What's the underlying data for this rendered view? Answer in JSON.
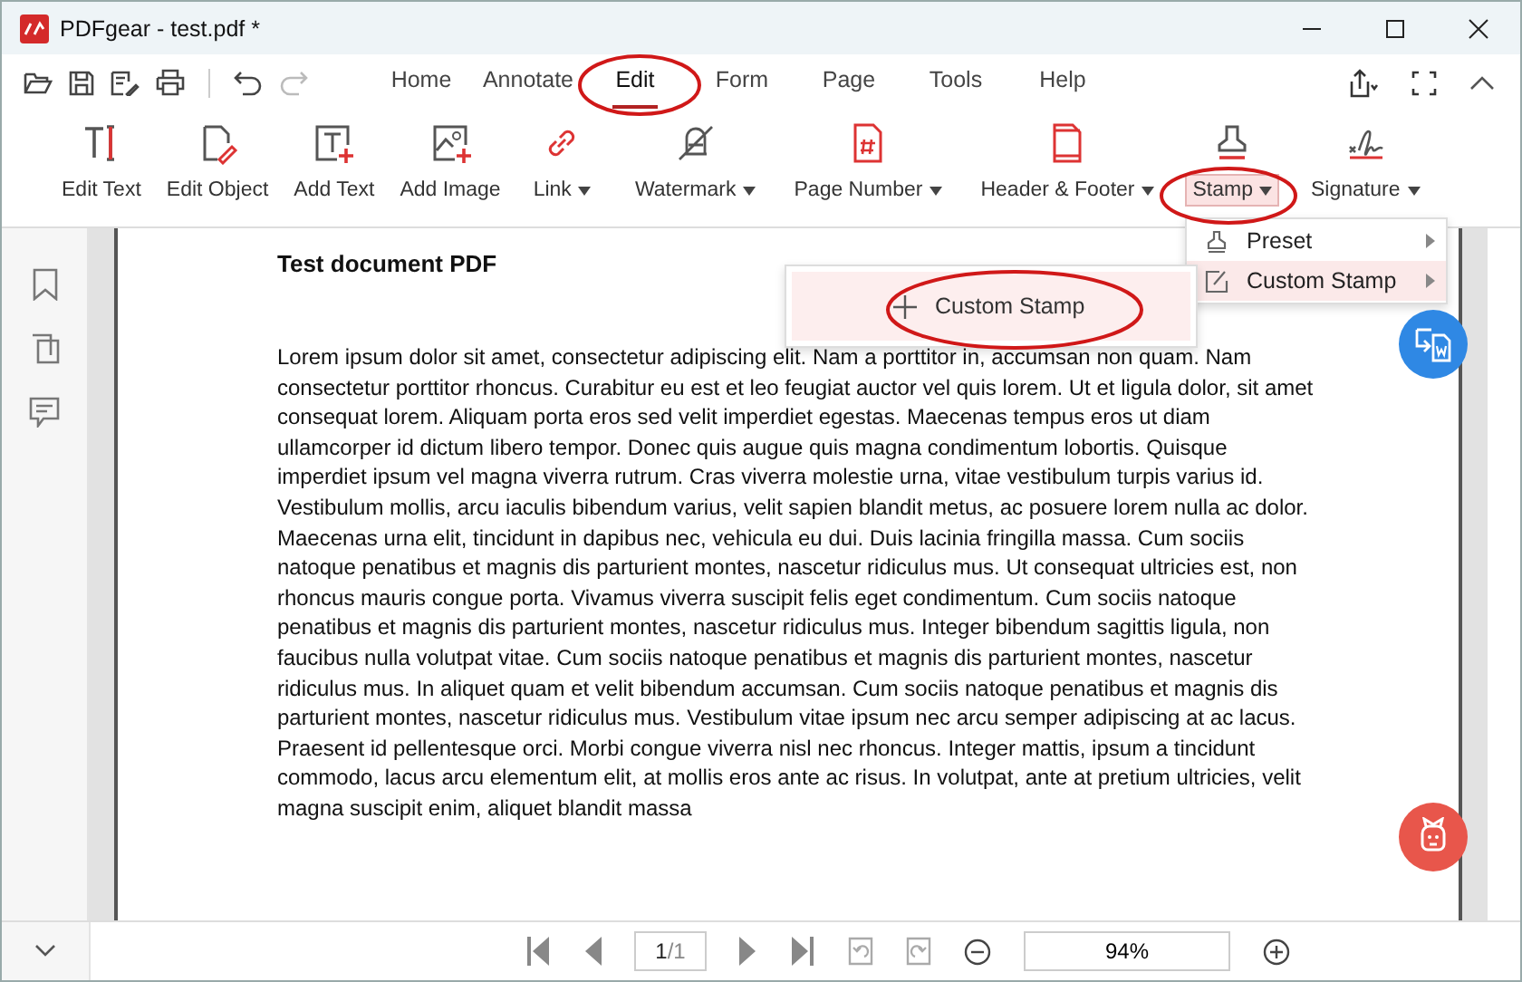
{
  "window": {
    "title": "PDFgear - test.pdf *"
  },
  "menu_tabs": [
    {
      "label": "Home",
      "selected": false
    },
    {
      "label": "Annotate",
      "selected": false
    },
    {
      "label": "Edit",
      "selected": true
    },
    {
      "label": "Form",
      "selected": false
    },
    {
      "label": "Page",
      "selected": false
    },
    {
      "label": "Tools",
      "selected": false
    },
    {
      "label": "Help",
      "selected": false
    }
  ],
  "tools": [
    {
      "label": "Edit Text",
      "dropdown": false,
      "selected": false
    },
    {
      "label": "Edit Object",
      "dropdown": false,
      "selected": false
    },
    {
      "label": "Add Text",
      "dropdown": false,
      "selected": false
    },
    {
      "label": "Add Image",
      "dropdown": false,
      "selected": false
    },
    {
      "label": "Link",
      "dropdown": true,
      "selected": false
    },
    {
      "label": "Watermark",
      "dropdown": true,
      "selected": false
    },
    {
      "label": "Page Number",
      "dropdown": true,
      "selected": false
    },
    {
      "label": "Header & Footer",
      "dropdown": true,
      "selected": false
    },
    {
      "label": "Stamp",
      "dropdown": true,
      "selected": true
    },
    {
      "label": "Signature",
      "dropdown": true,
      "selected": false
    }
  ],
  "stamp_menu": [
    {
      "label": "Preset",
      "selected": false
    },
    {
      "label": "Custom Stamp",
      "selected": true
    }
  ],
  "custom_stamp_submenu": [
    {
      "label": "Custom Stamp",
      "selected": true
    }
  ],
  "document": {
    "title": "Test document PDF",
    "body": "Lorem ipsum dolor sit amet, consectetur adipiscing elit. Nam a porttitor in, accumsan non quam. Nam consectetur porttitor rhoncus. Curabitur eu est et leo feugiat auctor vel quis lorem. Ut et ligula dolor, sit amet consequat lorem. Aliquam porta eros sed velit imperdiet egestas. Maecenas tempus eros ut diam ullamcorper id dictum libero tempor. Donec quis augue quis magna condimentum lobortis. Quisque imperdiet ipsum vel magna viverra rutrum. Cras viverra molestie urna, vitae vestibulum turpis varius id. Vestibulum mollis, arcu iaculis bibendum varius, velit sapien blandit metus, ac posuere lorem nulla ac dolor. Maecenas urna elit, tincidunt in dapibus nec, vehicula eu dui. Duis lacinia fringilla massa. Cum sociis natoque penatibus et magnis dis parturient montes, nascetur ridiculus mus. Ut consequat ultricies est, non rhoncus mauris congue porta. Vivamus viverra suscipit felis eget condimentum. Cum sociis natoque penatibus et magnis dis parturient montes, nascetur ridiculus mus. Integer bibendum sagittis ligula, non faucibus nulla volutpat vitae. Cum sociis natoque penatibus et magnis dis parturient montes, nascetur ridiculus mus. In aliquet quam et velit bibendum accumsan. Cum sociis natoque penatibus et magnis dis parturient montes, nascetur ridiculus mus. Vestibulum vitae ipsum nec arcu semper adipiscing at ac lacus. Praesent id pellentesque orci. Morbi congue viverra nisl nec rhoncus. Integer mattis, ipsum a tincidunt commodo, lacus arcu elementum elit, at mollis eros ante ac risus. In volutpat, ante at pretium ultricies, velit magna suscipit enim, aliquet blandit massa"
  },
  "pager": {
    "page": "1",
    "total": "/1",
    "zoom": "94%"
  }
}
